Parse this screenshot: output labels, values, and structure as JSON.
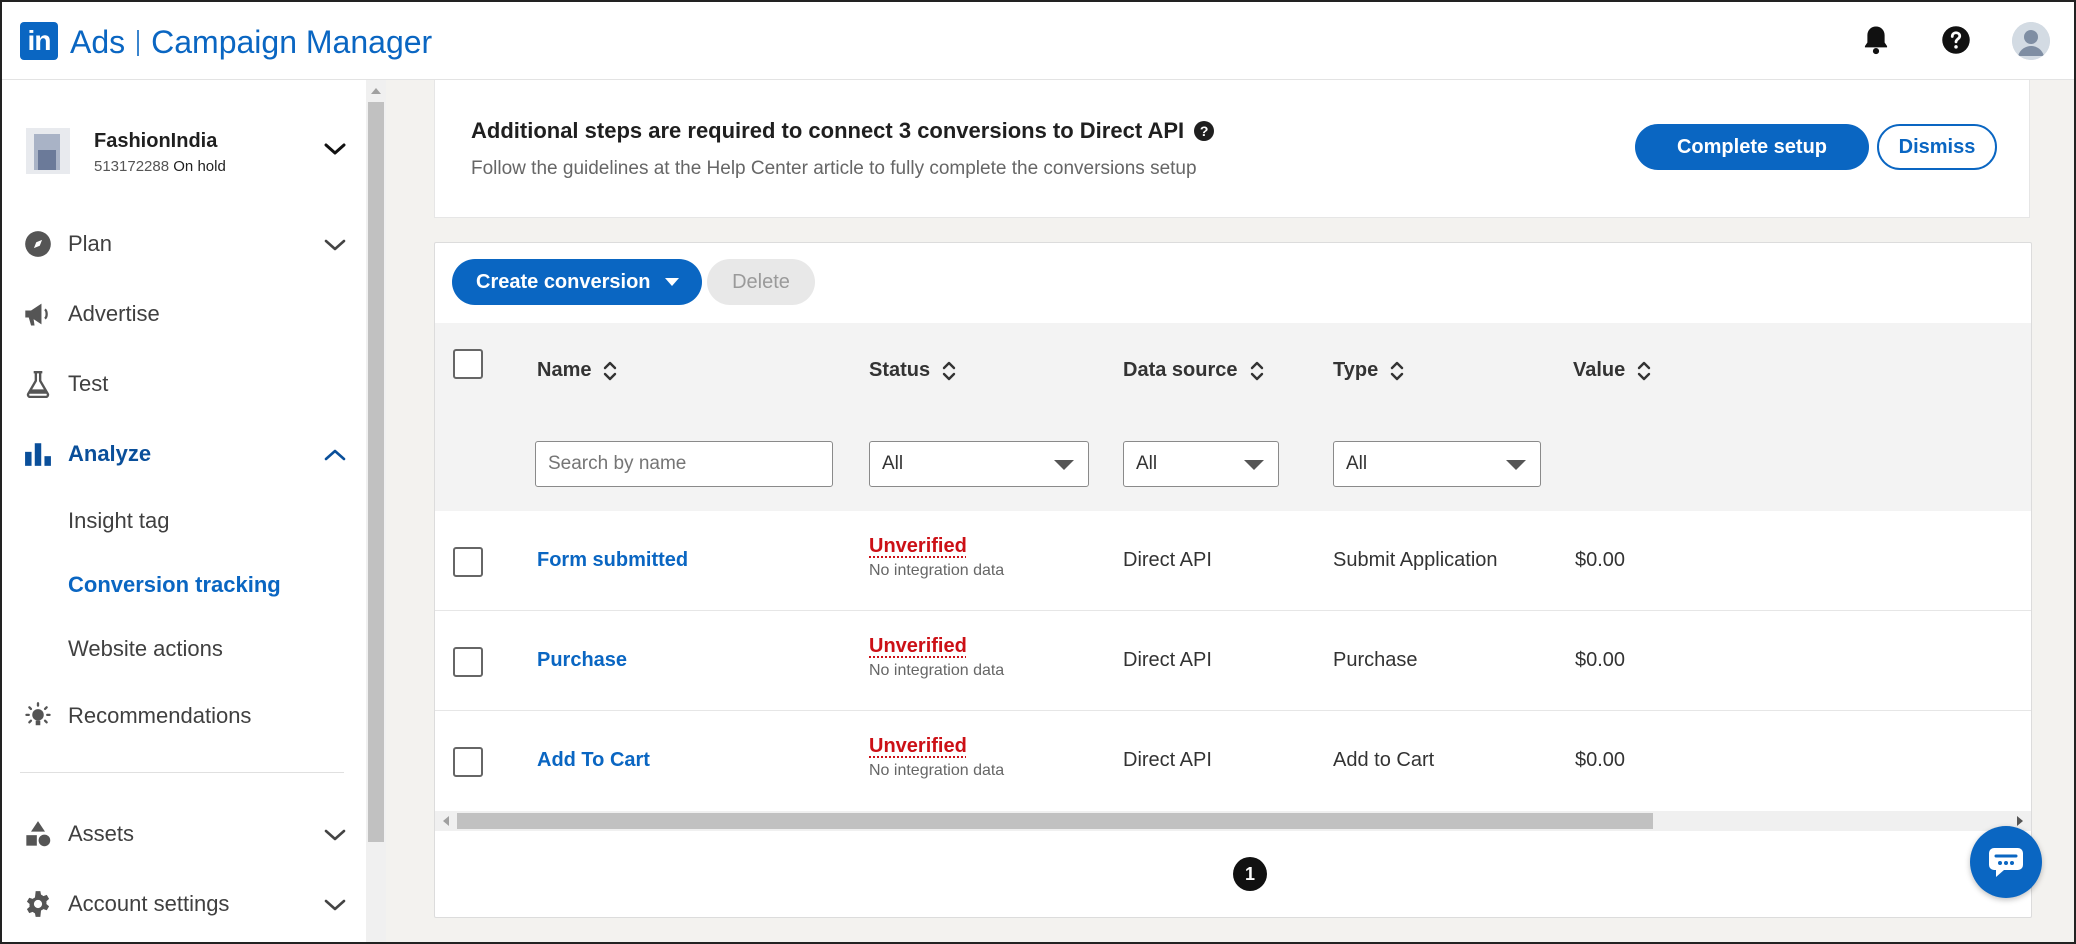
{
  "header": {
    "logo_text": "in",
    "brand_ads": "Ads",
    "brand_product": "Campaign Manager",
    "icons": [
      "bell-icon",
      "help-icon",
      "user-avatar"
    ]
  },
  "account": {
    "name": "FashionIndia",
    "id": "513172288",
    "status": "On hold"
  },
  "sidebar": {
    "items": [
      {
        "label": "Plan",
        "icon": "compass-icon",
        "expandable": true
      },
      {
        "label": "Advertise",
        "icon": "megaphone-icon",
        "expandable": false
      },
      {
        "label": "Test",
        "icon": "flask-icon",
        "expandable": false
      },
      {
        "label": "Analyze",
        "icon": "bar-chart-icon",
        "expandable": true,
        "expanded": true
      },
      {
        "label": "Recommendations",
        "icon": "lightbulb-icon",
        "expandable": false
      },
      {
        "label": "Assets",
        "icon": "shapes-icon",
        "expandable": true
      },
      {
        "label": "Account settings",
        "icon": "gear-icon",
        "expandable": true
      }
    ],
    "analyze_sub": [
      {
        "label": "Insight tag"
      },
      {
        "label": "Conversion tracking",
        "active": true
      },
      {
        "label": "Website actions"
      }
    ]
  },
  "banner": {
    "title": "Additional steps are required to connect 3 conversions to Direct API",
    "help_glyph": "?",
    "subtitle": "Follow the guidelines at the Help Center article to fully complete the conversions setup",
    "primary_button": "Complete setup",
    "secondary_button": "Dismiss"
  },
  "toolbar": {
    "create_label": "Create conversion",
    "delete_label": "Delete"
  },
  "table": {
    "columns": [
      "Name",
      "Status",
      "Data source",
      "Type",
      "Value"
    ],
    "filters": {
      "name_placeholder": "Search by name",
      "status": "All",
      "data_source": "All",
      "type": "All"
    },
    "rows": [
      {
        "name": "Form submitted",
        "status": "Unverified",
        "status_detail": "No integration data",
        "data_source": "Direct API",
        "type": "Submit Application",
        "value": "$0.00"
      },
      {
        "name": "Purchase",
        "status": "Unverified",
        "status_detail": "No integration data",
        "data_source": "Direct API",
        "type": "Purchase",
        "value": "$0.00"
      },
      {
        "name": "Add To Cart",
        "status": "Unverified",
        "status_detail": "No integration data",
        "data_source": "Direct API",
        "type": "Add to Cart",
        "value": "$0.00"
      }
    ]
  },
  "pagination": {
    "current_page": "1"
  },
  "colors": {
    "brand": "#0a66c2",
    "status_error": "#cc1016",
    "active_nav": "#0a4f9a"
  }
}
